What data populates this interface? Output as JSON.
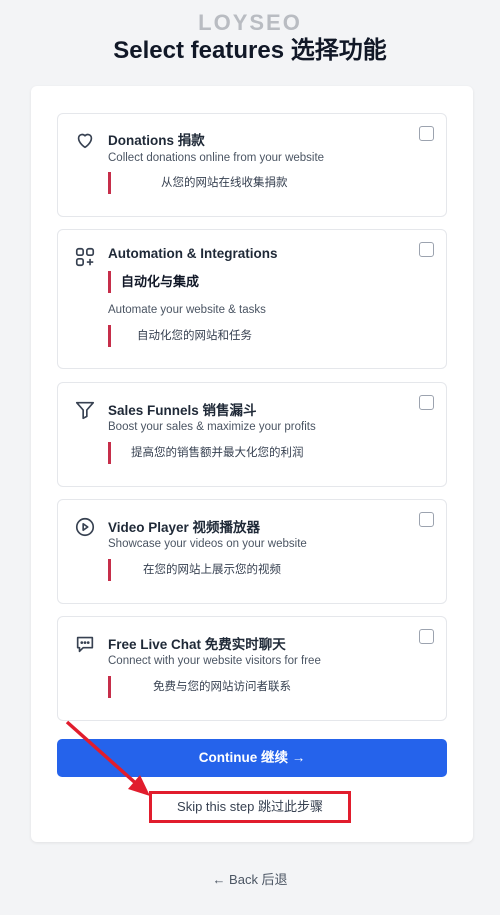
{
  "watermark": "LOYSEO",
  "page_title": "Select features 选择功能",
  "features": [
    {
      "icon": "heart-icon",
      "title": "Donations 捐款",
      "subtitle": "Collect donations online from your website",
      "note": "从您的网站在线收集捐款"
    },
    {
      "icon": "apps-plus-icon",
      "title": "Automation & Integrations",
      "title_cn": "自动化与集成",
      "subtitle": "Automate your website & tasks",
      "note": "自动化您的网站和任务"
    },
    {
      "icon": "funnel-icon",
      "title": "Sales Funnels 销售漏斗",
      "subtitle": "Boost your sales & maximize your profits",
      "note": "提高您的销售额并最大化您的利润"
    },
    {
      "icon": "play-circle-icon",
      "title": "Video Player 视频播放器",
      "subtitle": "Showcase your videos on your website",
      "note": "在您的网站上展示您的视频"
    },
    {
      "icon": "chat-icon",
      "title": "Free Live Chat 免费实时聊天",
      "subtitle": "Connect with your website visitors for free",
      "note": "免费与您的网站访问者联系"
    }
  ],
  "actions": {
    "continue_label": "Continue 继续 →",
    "skip_label": "Skip this step  跳过此步骤",
    "back_label": "← Back 后退"
  },
  "colors": {
    "primary": "#2563eb",
    "annotation_red": "#e11d2d",
    "note_bar": "#c62e4a"
  }
}
